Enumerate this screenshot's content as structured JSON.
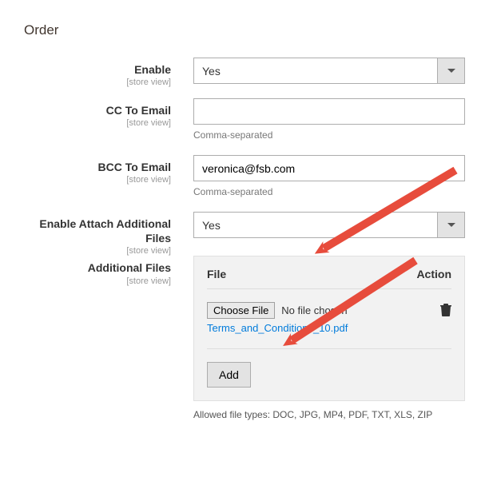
{
  "section": {
    "title": "Order"
  },
  "scope_label": "[store view]",
  "fields": {
    "enable": {
      "label": "Enable",
      "value": "Yes"
    },
    "cc": {
      "label": "CC To Email",
      "value": "",
      "help": "Comma-separated"
    },
    "bcc": {
      "label": "BCC To Email",
      "value": "veronica@fsb.com",
      "help": "Comma-separated"
    },
    "attach_enable": {
      "label": "Enable Attach Additional Files",
      "value": "Yes"
    },
    "additional_files": {
      "label": "Additional Files",
      "head_file": "File",
      "head_action": "Action",
      "choose_label": "Choose File",
      "no_file": "No file chosen",
      "existing_file": "Terms_and_Conditions_10.pdf",
      "add_label": "Add",
      "allowed": "Allowed file types: DOC, JPG, MP4, PDF, TXT, XLS, ZIP"
    }
  }
}
